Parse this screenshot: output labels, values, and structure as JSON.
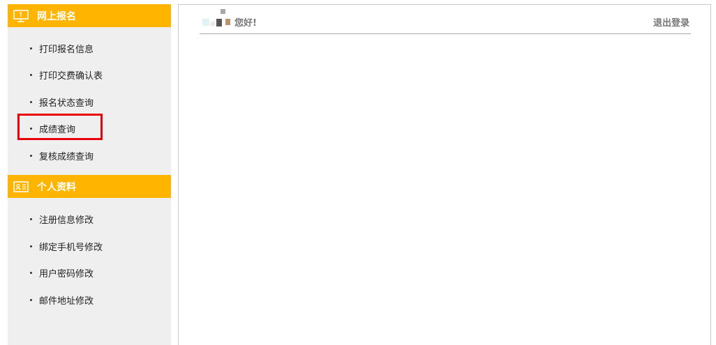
{
  "sidebar": {
    "sections": [
      {
        "title": "网上报名",
        "icon": "monitor-icon",
        "items": [
          "打印报名信息",
          "打印交费确认表",
          "报名状态查询",
          "成绩查询",
          "复核成绩查询"
        ]
      },
      {
        "title": "个人资料",
        "icon": "id-card-icon",
        "items": [
          "注册信息修改",
          "绑定手机号修改",
          "用户密码修改",
          "邮件地址修改"
        ]
      }
    ],
    "highlighted_item": "成绩查询"
  },
  "header": {
    "greeting": "您好!",
    "logout_label": "退出登录"
  },
  "colors": {
    "accent": "#ffb400",
    "highlight": "#e8000b",
    "sidebar_bg": "#efefef"
  }
}
